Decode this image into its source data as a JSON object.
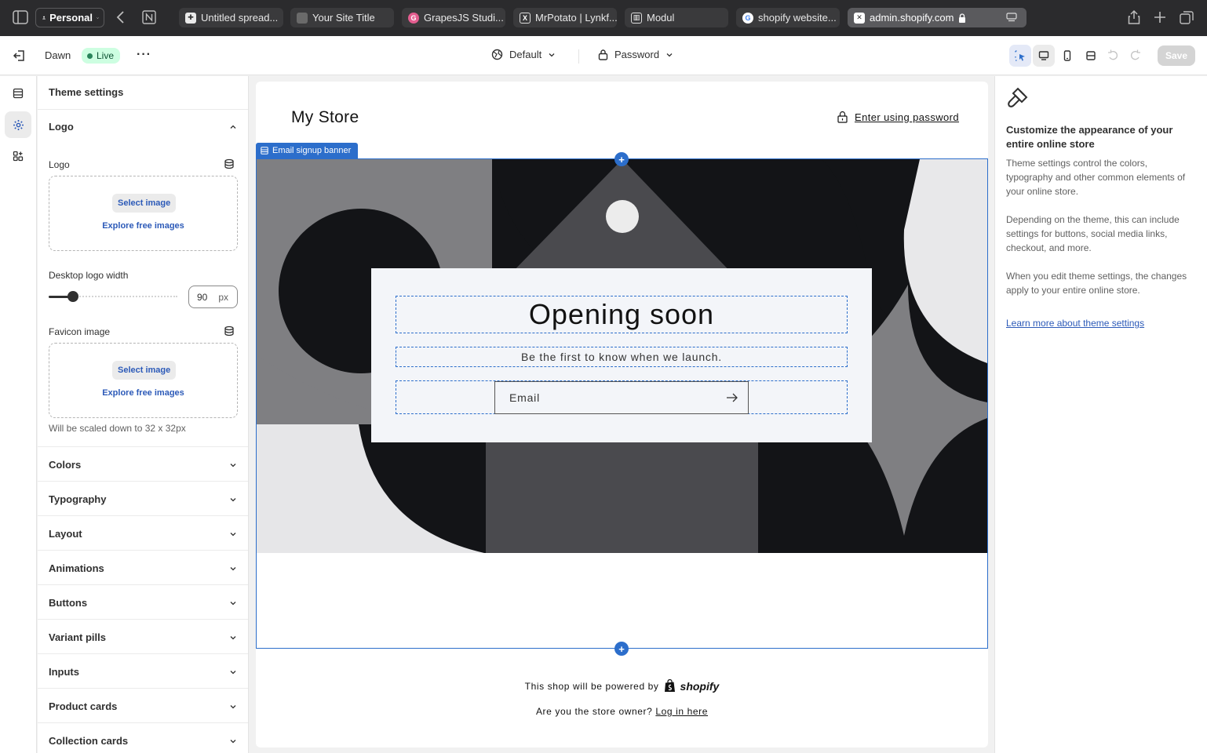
{
  "browser": {
    "profile": "Personal",
    "tabs": [
      {
        "title": "Untitled spread...",
        "icon": "sheets-icon"
      },
      {
        "title": "Your Site Title",
        "icon": "cube-icon"
      },
      {
        "title": "GrapesJS Studi...",
        "icon": "grapesjs-icon"
      },
      {
        "title": "MrPotato | Lynkf...",
        "icon": "x-icon"
      },
      {
        "title": "Modul",
        "icon": "modul-icon"
      },
      {
        "title": "shopify website...",
        "icon": "google-icon"
      },
      {
        "title": "admin.shopify.com",
        "icon": "shopify-icon",
        "active": true
      }
    ]
  },
  "header": {
    "theme_name": "Dawn",
    "status": "Live",
    "template": "Default",
    "page": "Password",
    "save_label": "Save"
  },
  "panel": {
    "title": "Theme settings",
    "logo_section": "Logo",
    "logo_label": "Logo",
    "select_image": "Select image",
    "explore_images": "Explore free images",
    "width_label": "Desktop logo width",
    "width_value": "90",
    "width_unit": "px",
    "favicon_label": "Favicon image",
    "favicon_hint": "Will be scaled down to 32 x 32px",
    "sections": [
      "Colors",
      "Typography",
      "Layout",
      "Animations",
      "Buttons",
      "Variant pills",
      "Inputs",
      "Product cards",
      "Collection cards"
    ]
  },
  "preview": {
    "store_name": "My Store",
    "password_link": "Enter using password",
    "section_tag": "Email signup banner",
    "heading": "Opening soon",
    "subheading": "Be the first to know when we launch.",
    "email_placeholder": "Email",
    "powered_by": "This shop will be powered by",
    "shopify_word": "shopify",
    "owner_text": "Are you the store owner?",
    "login_link": "Log in here"
  },
  "info": {
    "title": "Customize the appearance of your entire online store",
    "p1": "Theme settings control the colors, typography and other common elements of your online store.",
    "p2": "Depending on the theme, this can include settings for buttons, social media links, checkout, and more.",
    "p3": "When you edit theme settings, the changes apply to your entire online store.",
    "link": "Learn more about theme settings"
  },
  "colors": {
    "accent": "#2c6ecb",
    "live_bg": "#cdfee1",
    "link": "#2c5ab8"
  }
}
